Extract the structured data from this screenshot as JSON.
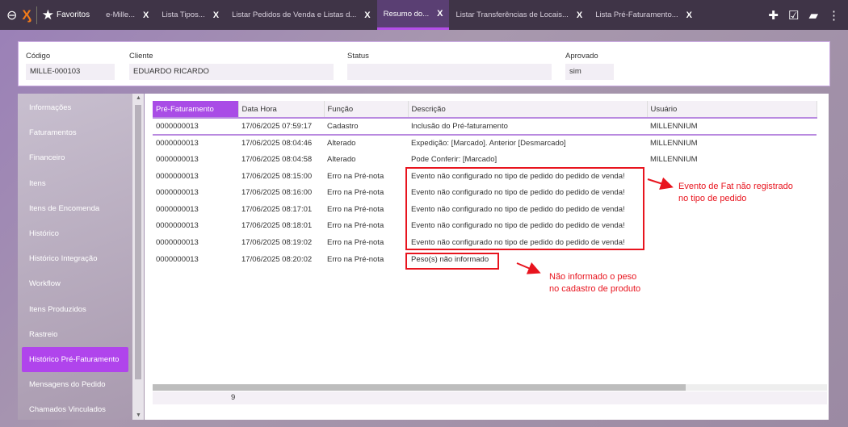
{
  "topbar": {
    "favorites": "Favoritos",
    "tabs": [
      {
        "label": "e-Mille...",
        "active": false
      },
      {
        "label": "Lista Tipos...",
        "active": false
      },
      {
        "label": "Listar Pedidos de Venda e Listas d...",
        "active": false
      },
      {
        "label": "Resumo do...",
        "active": true
      },
      {
        "label": "Listar Transferências de Locais...",
        "active": false
      },
      {
        "label": "Lista Pré-Faturamento...",
        "active": false
      }
    ],
    "close": "X"
  },
  "header": {
    "codigo_label": "Código",
    "codigo": "MILLE-000103",
    "cliente_label": "Cliente",
    "cliente": "EDUARDO RICARDO",
    "status_label": "Status",
    "status": "",
    "aprovado_label": "Aprovado",
    "aprovado": "sim"
  },
  "sidebar": {
    "items": [
      "Informações",
      "Faturamentos",
      "Financeiro",
      "Itens",
      "Itens de Encomenda",
      "Histórico",
      "Histórico Integração",
      "Workflow",
      "Itens Produzidos",
      "Rastreio",
      "Histórico Pré-Faturamento",
      "Mensagens do Pedido",
      "Chamados Vinculados"
    ],
    "active": "Histórico Pré-Faturamento"
  },
  "table": {
    "columns": [
      "Pré-Faturamento",
      "Data Hora",
      "Função",
      "Descrição",
      "Usuário"
    ],
    "rows": [
      [
        "0000000013",
        "17/06/2025 07:59:17",
        "Cadastro",
        "Inclusão do Pré-faturamento",
        "MILLENNIUM"
      ],
      [
        "0000000013",
        "17/06/2025 08:04:46",
        "Alterado",
        "Expedição: [Marcado]. Anterior [Desmarcado]",
        "MILLENNIUM"
      ],
      [
        "0000000013",
        "17/06/2025 08:04:58",
        "Alterado",
        "Pode Conferir: [Marcado]",
        "MILLENNIUM"
      ],
      [
        "0000000013",
        "17/06/2025 08:15:00",
        "Erro na Pré-nota",
        "Evento não configurado no tipo de pedido do pedido de venda!",
        ""
      ],
      [
        "0000000013",
        "17/06/2025 08:16:00",
        "Erro na Pré-nota",
        "Evento não configurado no tipo de pedido do pedido de venda!",
        ""
      ],
      [
        "0000000013",
        "17/06/2025 08:17:01",
        "Erro na Pré-nota",
        "Evento não configurado no tipo de pedido do pedido de venda!",
        ""
      ],
      [
        "0000000013",
        "17/06/2025 08:18:01",
        "Erro na Pré-nota",
        "Evento não configurado no tipo de pedido do pedido de venda!",
        ""
      ],
      [
        "0000000013",
        "17/06/2025 08:19:02",
        "Erro na Pré-nota",
        "Evento não configurado no tipo de pedido do pedido de venda!",
        ""
      ],
      [
        "0000000013",
        "17/06/2025 08:20:02",
        "Erro na Pré-nota",
        "Peso(s) não informado",
        ""
      ]
    ],
    "count": "9"
  },
  "annotations": {
    "note1": [
      "Evento de Fat não registrado",
      "no tipo de pedido"
    ],
    "note2": [
      "Não informado o peso",
      "no cadastro de produto"
    ],
    "color": "#e8141e"
  },
  "colors": {
    "accent": "#b044ec",
    "topbar": "#3f3447"
  }
}
